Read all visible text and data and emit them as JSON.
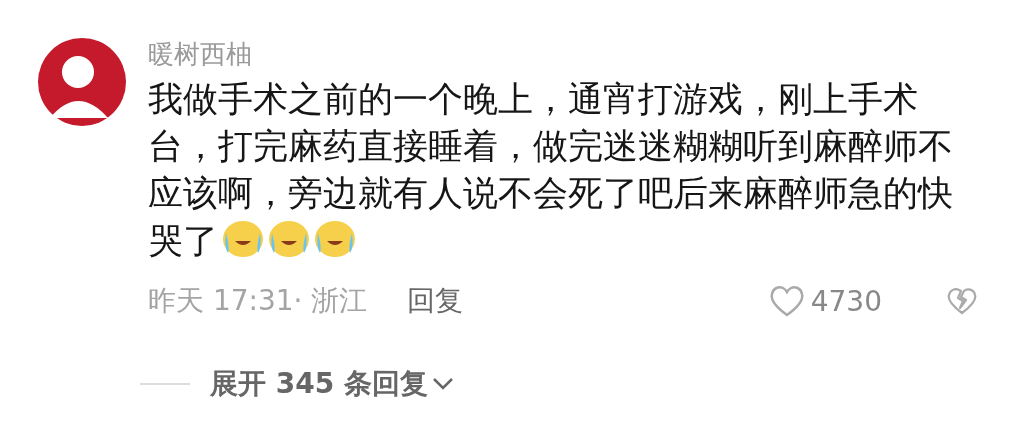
{
  "comment": {
    "author": "暖树西柚",
    "text_lines": [
      "我做手术之前的一个晚上，通宵打游戏，刚上手术",
      "台，打完麻药直接睡着，做完迷迷糊糊听到麻醉师不",
      "应该啊，旁边就有人说不会死了吧后来麻醉师急的快",
      "哭了"
    ],
    "emojis": [
      {
        "kind": "tears-of-joy"
      },
      {
        "kind": "tears-of-joy"
      },
      {
        "kind": "tears-of-joy"
      }
    ],
    "time_location": "昨天 17:31· 浙江",
    "reply": "回复",
    "likes": "4730",
    "liked": false
  },
  "expand": {
    "label": "展开 345 条回复"
  }
}
